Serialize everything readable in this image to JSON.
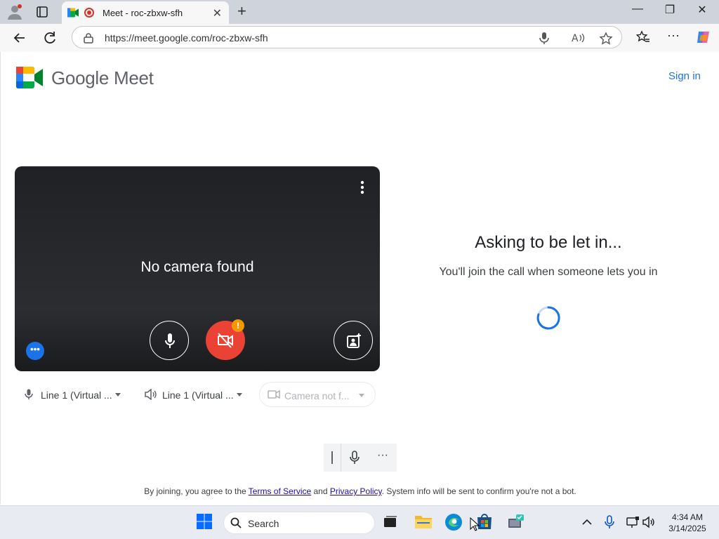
{
  "browser": {
    "tab_title": "Meet - roc-zbxw-sfh",
    "tab_close": "✕",
    "new_tab": "+",
    "url": "https://meet.google.com/roc-zbxw-sfh",
    "window_controls": [
      "—",
      "❐",
      "✕"
    ],
    "toolbar_dots": "···"
  },
  "header": {
    "brand": "Google Meet",
    "sign_in": "Sign in"
  },
  "preview": {
    "message": "No camera found",
    "camera_badge": "!",
    "more_label": "•••"
  },
  "devices": {
    "microphone": "Line 1 (Virtual ...",
    "speaker": "Line 1 (Virtual ...",
    "camera": "Camera not f..."
  },
  "status": {
    "title": "Asking to be let in...",
    "description": "You'll join the call when someone lets you in"
  },
  "minibar": {
    "more": "···"
  },
  "footer": {
    "prefix": "By joining, you agree to the ",
    "terms": "Terms of Service",
    "and": " and ",
    "privacy": "Privacy Policy",
    "suffix": ". System info will be sent to confirm you're not a bot."
  },
  "taskbar": {
    "search_label": "Search",
    "time": "4:34 AM",
    "date": "3/14/2025"
  },
  "colors": {
    "accent_blue": "#1a73e8",
    "camera_off_red": "#ea4335",
    "warning_orange": "#f29900"
  }
}
